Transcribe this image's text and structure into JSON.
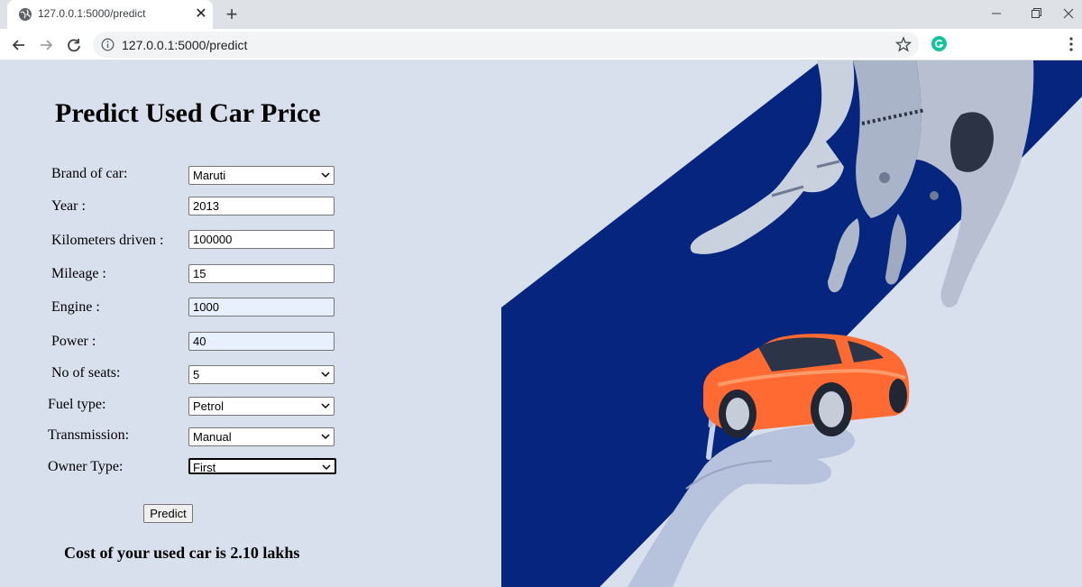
{
  "browser": {
    "tab_title": "127.0.0.1:5000/predict",
    "tab_close": "✕",
    "new_tab": "+",
    "url": "127.0.0.1:5000/predict",
    "icons": [
      "globe-icon",
      "close-icon",
      "plus-icon",
      "minimize-icon",
      "restore-icon",
      "back-icon",
      "forward-icon",
      "reload-icon",
      "info-icon",
      "star-icon",
      "grammarly-icon",
      "menu-icon"
    ]
  },
  "page": {
    "title": "Predict Used Car Price",
    "fields": [
      {
        "label": "Brand of car:",
        "value": "Maruti",
        "type": "select"
      },
      {
        "label": "Year :",
        "value": "2013",
        "type": "input"
      },
      {
        "label": "Kilometers driven :",
        "value": "100000",
        "type": "input"
      },
      {
        "label": "Mileage :",
        "value": "15",
        "type": "input"
      },
      {
        "label": "Engine :",
        "value": "1000",
        "type": "input"
      },
      {
        "label": "Power :",
        "value": "40",
        "type": "input"
      },
      {
        "label": "No of seats:",
        "value": "5",
        "type": "select"
      },
      {
        "label": "Fuel type:",
        "value": "Petrol",
        "type": "select"
      },
      {
        "label": "Transmission:",
        "value": "Manual",
        "type": "select"
      },
      {
        "label": "Owner Type:",
        "value": "First",
        "type": "select"
      }
    ],
    "predict_label": "Predict",
    "result": "Cost of your used car is 2.10 lakhs"
  },
  "colors": {
    "page_bg": "#d8dfed",
    "hero_navy": "#05257e",
    "car_orange": "#ff6a33"
  }
}
